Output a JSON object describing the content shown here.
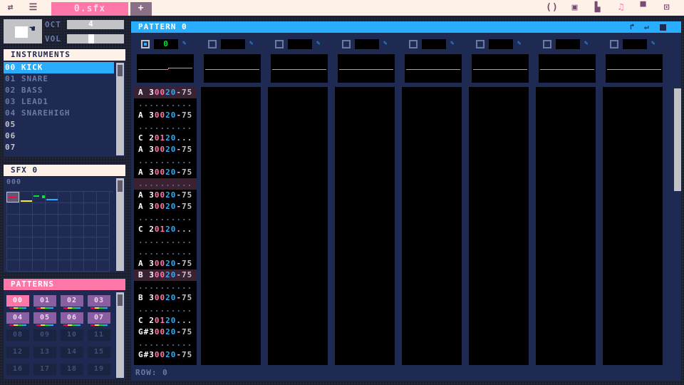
{
  "topbar": {
    "file_tab": "0.sfx",
    "add_tab": "+",
    "left_icons": [
      "swap-icon",
      "menu-icon"
    ],
    "right_icons": [
      "code-icon",
      "save-icon",
      "sprite-icon",
      "music-icon",
      "map-icon",
      "tv-icon"
    ]
  },
  "controls": {
    "oct_label": "OCT",
    "oct_value": "4",
    "vol_label": "VOL"
  },
  "instruments": {
    "title": "INSTRUMENTS",
    "items": [
      "00 KICK",
      "01 SNARE",
      "02 BASS",
      "03 LEAD1",
      "04 SNAREHIGH",
      "05",
      "06",
      "07"
    ]
  },
  "sfx": {
    "title": "SFX 0",
    "index": "000"
  },
  "patterns": {
    "title": "PATTERNS",
    "items": [
      "00",
      "01",
      "02",
      "03",
      "04",
      "05",
      "06",
      "07",
      "08",
      "09",
      "10",
      "11",
      "12",
      "13",
      "14",
      "15",
      "16",
      "17",
      "18",
      "19"
    ]
  },
  "pattern_editor": {
    "title": "PATTERN 0",
    "channel0_number": "0",
    "row_label": "ROW: 0",
    "rows": [
      {
        "n": "A 3",
        "i": "00",
        "v": "20",
        "f": "-75",
        "hl": true
      },
      {
        "n": "...",
        "i": "..",
        "v": "..",
        "f": "...",
        "hl": false
      },
      {
        "n": "A 3",
        "i": "00",
        "v": "20",
        "f": "-75",
        "hl": false
      },
      {
        "n": "...",
        "i": "..",
        "v": "..",
        "f": "...",
        "hl": false
      },
      {
        "n": "C 2",
        "i": "01",
        "v": "20",
        "f": "...",
        "hl": false
      },
      {
        "n": "A 3",
        "i": "00",
        "v": "20",
        "f": "-75",
        "hl": false
      },
      {
        "n": "...",
        "i": "..",
        "v": "..",
        "f": "...",
        "hl": false
      },
      {
        "n": "A 3",
        "i": "00",
        "v": "20",
        "f": "-75",
        "hl": false
      },
      {
        "n": "...",
        "i": "..",
        "v": "..",
        "f": "...",
        "hl": true
      },
      {
        "n": "A 3",
        "i": "00",
        "v": "20",
        "f": "-75",
        "hl": false
      },
      {
        "n": "A 3",
        "i": "00",
        "v": "20",
        "f": "-75",
        "hl": false
      },
      {
        "n": "...",
        "i": "..",
        "v": "..",
        "f": "...",
        "hl": false
      },
      {
        "n": "C 2",
        "i": "01",
        "v": "20",
        "f": "...",
        "hl": false
      },
      {
        "n": "...",
        "i": "..",
        "v": "..",
        "f": "...",
        "hl": false
      },
      {
        "n": "...",
        "i": "..",
        "v": "..",
        "f": "...",
        "hl": false
      },
      {
        "n": "A 3",
        "i": "00",
        "v": "20",
        "f": "-75",
        "hl": false
      },
      {
        "n": "B 3",
        "i": "00",
        "v": "20",
        "f": "-75",
        "hl": true
      },
      {
        "n": "...",
        "i": "..",
        "v": "..",
        "f": "...",
        "hl": false
      },
      {
        "n": "B 3",
        "i": "00",
        "v": "20",
        "f": "-75",
        "hl": false
      },
      {
        "n": "...",
        "i": "..",
        "v": "..",
        "f": "...",
        "hl": false
      },
      {
        "n": "C 2",
        "i": "01",
        "v": "20",
        "f": "...",
        "hl": false
      },
      {
        "n": "G#3",
        "i": "00",
        "v": "20",
        "f": "-75",
        "hl": false
      },
      {
        "n": "...",
        "i": "..",
        "v": "..",
        "f": "...",
        "hl": false
      },
      {
        "n": "G#3",
        "i": "00",
        "v": "20",
        "f": "-75",
        "hl": false
      }
    ]
  },
  "colors": {
    "pink": "#ff77a8",
    "blue": "#29adff",
    "navy": "#1f2a52",
    "green": "#00e436"
  }
}
